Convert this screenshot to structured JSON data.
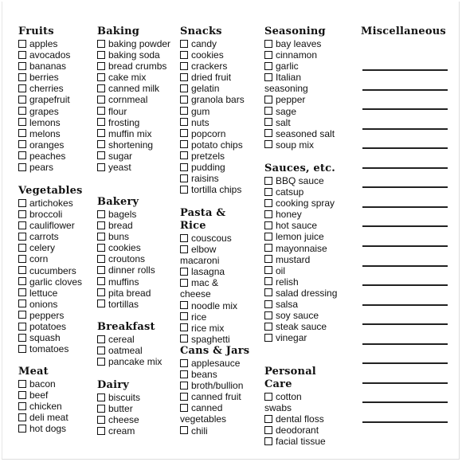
{
  "sections": {
    "fruits": {
      "title": "Fruits",
      "items": [
        "apples",
        "avocados",
        "bananas",
        "berries",
        "cherries",
        "grapefruit",
        "grapes",
        "lemons",
        "melons",
        "oranges",
        "peaches",
        "pears"
      ]
    },
    "vegetables": {
      "title": "Vegetables",
      "items": [
        "artichokes",
        "broccoli",
        "cauliflower",
        "carrots",
        "celery",
        "corn",
        "cucumbers",
        "garlic cloves",
        "lettuce",
        "onions",
        "peppers",
        "potatoes",
        "squash",
        "tomatoes"
      ]
    },
    "meat": {
      "title": "Meat",
      "items": [
        "bacon",
        "beef",
        "chicken",
        "deli meat",
        "hot dogs"
      ]
    },
    "baking": {
      "title": "Baking",
      "items": [
        "baking powder",
        "baking soda",
        "bread crumbs",
        "cake mix",
        "canned milk",
        "cornmeal",
        "flour",
        "frosting",
        "muffin mix",
        "shortening",
        "sugar",
        "yeast"
      ]
    },
    "bakery": {
      "title": "Bakery",
      "items": [
        "bagels",
        "bread",
        "buns",
        "cookies",
        "croutons",
        "dinner rolls",
        "muffins",
        "pita bread",
        "tortillas"
      ]
    },
    "breakfast": {
      "title": "Breakfast",
      "items": [
        "cereal",
        "oatmeal",
        "pancake mix"
      ]
    },
    "dairy": {
      "title": "Dairy",
      "items": [
        "biscuits",
        "butter",
        "cheese",
        "cream"
      ]
    },
    "snacks": {
      "title": "Snacks",
      "items": [
        "candy",
        "cookies",
        "crackers",
        "dried fruit",
        "gelatin",
        "granola bars",
        "gum",
        "nuts",
        "popcorn",
        "potato chips",
        "pretzels",
        "pudding",
        "raisins",
        "tortilla chips"
      ]
    },
    "pasta_rice": {
      "title": "Pasta & Rice",
      "items": [
        "couscous",
        "elbow macaroni",
        "lasagna",
        "mac & cheese",
        "noodle mix",
        "rice",
        "rice mix",
        "spaghetti"
      ]
    },
    "cans_jars": {
      "title": "Cans & Jars",
      "items": [
        "applesauce",
        "beans",
        "broth/bullion",
        "canned fruit",
        "canned vegetables",
        "chili"
      ]
    },
    "seasoning": {
      "title": "Seasoning",
      "items": [
        "bay leaves",
        "cinnamon",
        "garlic",
        "Italian seasoning",
        "pepper",
        "sage",
        "salt",
        "seasoned salt",
        "soup mix"
      ]
    },
    "sauces": {
      "title": "Sauces, etc.",
      "items": [
        "BBQ sauce",
        "catsup",
        "cooking spray",
        "honey",
        "hot sauce",
        "lemon juice",
        "mayonnaise",
        "mustard",
        "oil",
        "relish",
        "salad dressing",
        "salsa",
        "soy sauce",
        "steak sauce",
        "vinegar"
      ]
    },
    "personal_care": {
      "title": "Personal Care",
      "items": [
        "cotton swabs",
        "dental floss",
        "deodorant",
        "facial tissue"
      ]
    },
    "miscellaneous": {
      "title": "Miscellaneous",
      "blank_lines": 19
    }
  }
}
